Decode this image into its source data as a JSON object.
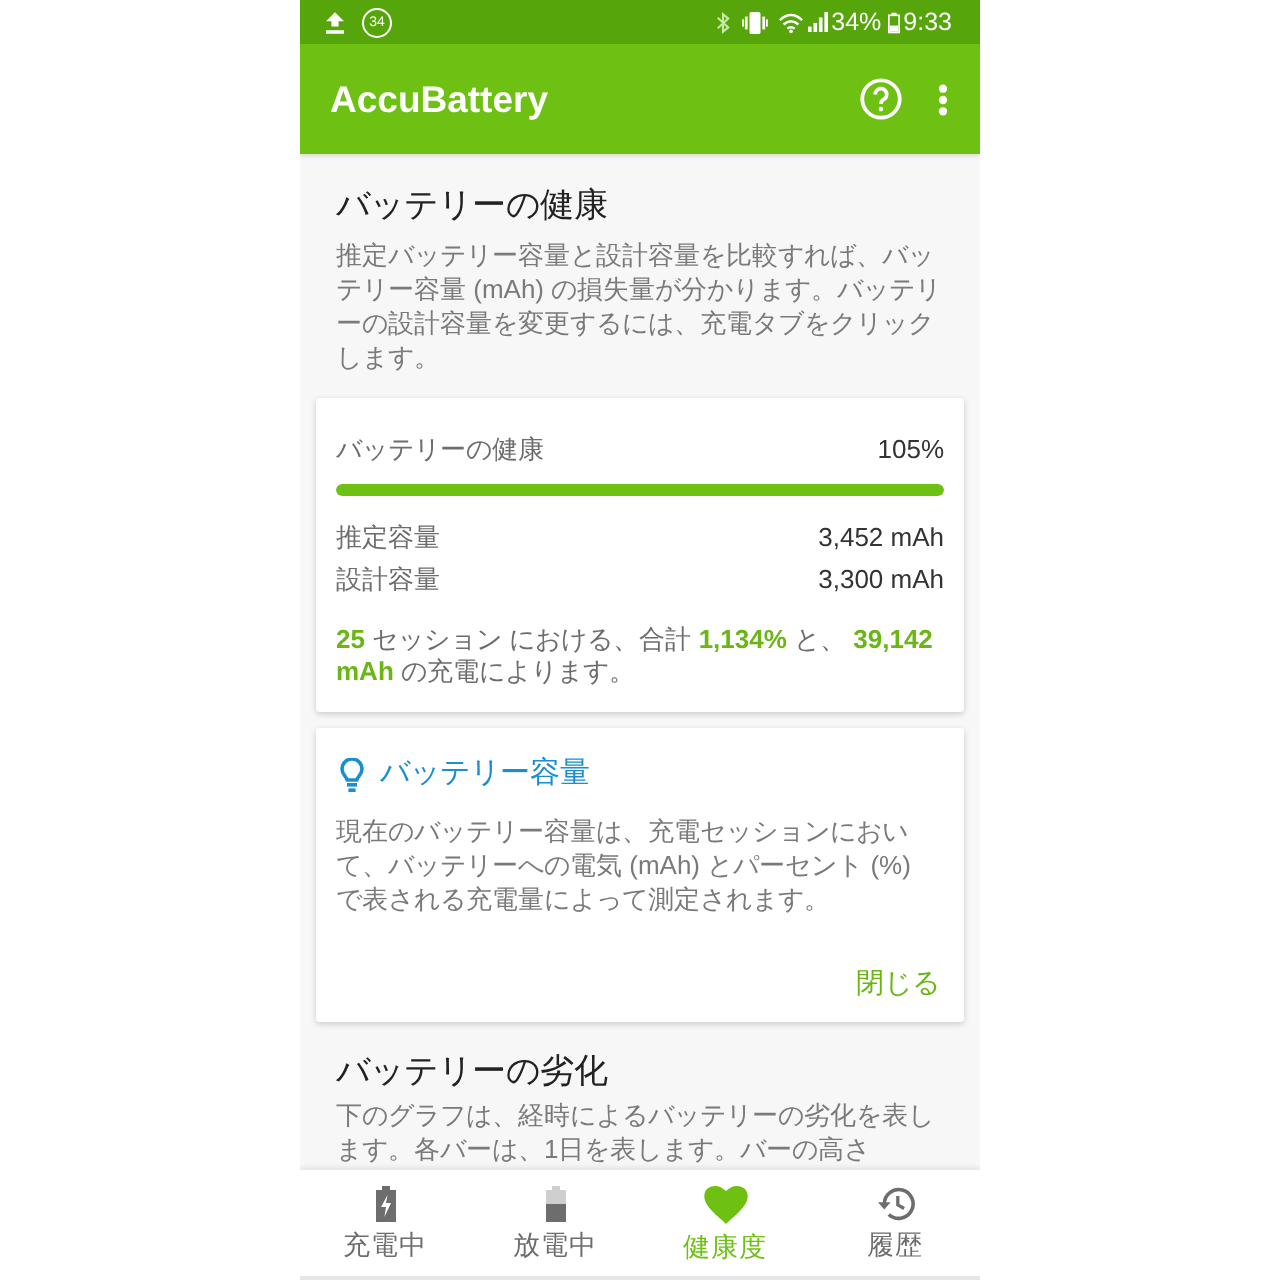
{
  "status_bar": {
    "notification_count": "34",
    "battery": "34%",
    "time": "9:33"
  },
  "app_bar": {
    "title": "AccuBattery"
  },
  "health_section": {
    "title": "バッテリーの健康",
    "description": "推定バッテリー容量と設計容量を比較すれば、バッテリー容量 (mAh) の損失量が分かります。バッテリーの設計容量を変更するには、充電タブをクリックします。"
  },
  "health_card": {
    "label": "バッテリーの健康",
    "value": "105%",
    "level": 1,
    "rows": [
      {
        "label": "推定容量",
        "value": "3,452 mAh"
      },
      {
        "label": "設計容量",
        "value": "3,300 mAh"
      }
    ],
    "summary": "**25** セッション における、合計 **1,134%** と、 **39,142 mAh** の充電によります。"
  },
  "info_card": {
    "title": "バッテリー容量",
    "text": "現在のバッテリー容量は、充電セッションにおいて、バッテリーへの電気 (mAh) とパーセント (%) で表される充電量によって測定されます。",
    "close_button": "閉じる"
  },
  "wear_section": {
    "title": "バッテリーの劣化",
    "description": "下のグラフは、経時によるバッテリーの劣化を表します。各バーは、1日を表します。バーの高さ"
  },
  "bottom_nav": [
    {
      "kind": "charging",
      "label": "充電中",
      "selected": false
    },
    {
      "kind": "discharging",
      "label": "放電中",
      "selected": false
    },
    {
      "kind": "health",
      "label": "健康度",
      "selected": true
    },
    {
      "kind": "history",
      "label": "履歴",
      "selected": false
    }
  ]
}
